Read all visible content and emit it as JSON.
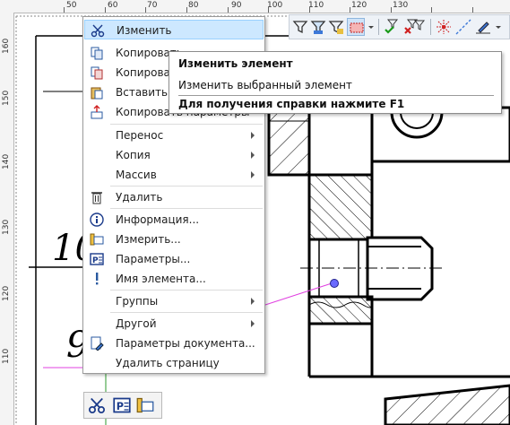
{
  "ruler": {
    "top": [
      "50",
      "60",
      "70",
      "80",
      "90",
      "100",
      "110",
      "120",
      "130"
    ],
    "left": [
      "160",
      "150",
      "140",
      "130",
      "120",
      "110"
    ]
  },
  "drawing": {
    "text_10": "10",
    "text_9": "9"
  },
  "context_menu": {
    "items": [
      {
        "label": "Изменить",
        "icon": "scissors-edit-icon",
        "highlighted": true
      },
      {
        "label": "Копировать",
        "icon": "copy-icon"
      },
      {
        "label": "Копировать",
        "icon": "copy-base-icon"
      },
      {
        "label": "Вставить из",
        "icon": "paste-icon"
      },
      {
        "label": "Копировать параметры",
        "icon": "copy-params-icon"
      },
      {
        "label": "Перенос",
        "submenu": true
      },
      {
        "label": "Копия",
        "submenu": true
      },
      {
        "label": "Массив",
        "submenu": true
      },
      {
        "label": "Удалить",
        "icon": "trash-icon"
      },
      {
        "label": "Информация...",
        "icon": "info-icon"
      },
      {
        "label": "Измерить...",
        "icon": "measure-icon"
      },
      {
        "label": "Параметры...",
        "icon": "parameters-icon"
      },
      {
        "label": "Имя элемента...",
        "icon": "exclamation-icon"
      },
      {
        "label": "Группы",
        "submenu": true
      },
      {
        "label": "Другой",
        "submenu": true
      },
      {
        "label": "Параметры документа...",
        "icon": "document-settings-icon"
      },
      {
        "label": "Удалить страницу"
      }
    ]
  },
  "tooltip": {
    "title": "Изменить элемент",
    "description": "Изменить выбранный элемент",
    "help": "Для получения справки нажмите F1"
  },
  "toolbar": {
    "icons": [
      "filter-icon",
      "filter-layer-icon",
      "filter-type-icon",
      "select-rect-icon",
      "dropdown-icon",
      "filter-accept-icon",
      "filter-clear-icon",
      "filter-settings-icon",
      "snap-point-icon",
      "snap-line-icon",
      "pen-icon",
      "dropdown-icon"
    ]
  },
  "bottom_toolbar": {
    "icons": [
      "scissors-edit-icon",
      "parameters-icon",
      "measure-icon"
    ]
  },
  "colors": {
    "highlight_bg": "#cde8ff",
    "highlight_border": "#99d1ff",
    "construction_line": "#e040e0",
    "point_marker": "#6a6aff"
  }
}
